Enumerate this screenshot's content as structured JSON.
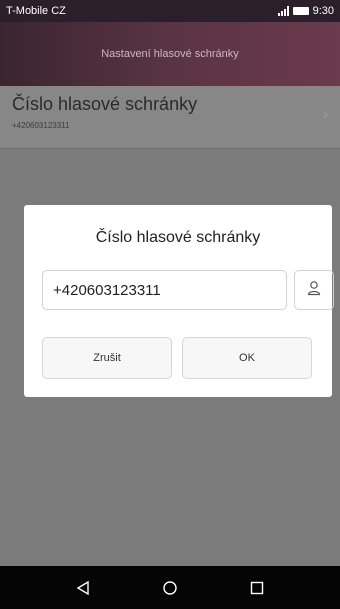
{
  "status_bar": {
    "carrier": "T-Mobile CZ",
    "time": "9:30"
  },
  "header": {
    "title": "Nastavení hlasové schránky"
  },
  "list": {
    "item_title": "Číslo hlasové schránky",
    "item_subtitle": "+420603123311"
  },
  "dialog": {
    "title": "Číslo hlasové schránky",
    "phone_value": "+420603123311",
    "cancel_label": "Zrušit",
    "ok_label": "OK"
  },
  "icons": {
    "contact": "person-icon",
    "back": "back-triangle-icon",
    "home": "home-circle-icon",
    "recents": "recents-square-icon"
  }
}
